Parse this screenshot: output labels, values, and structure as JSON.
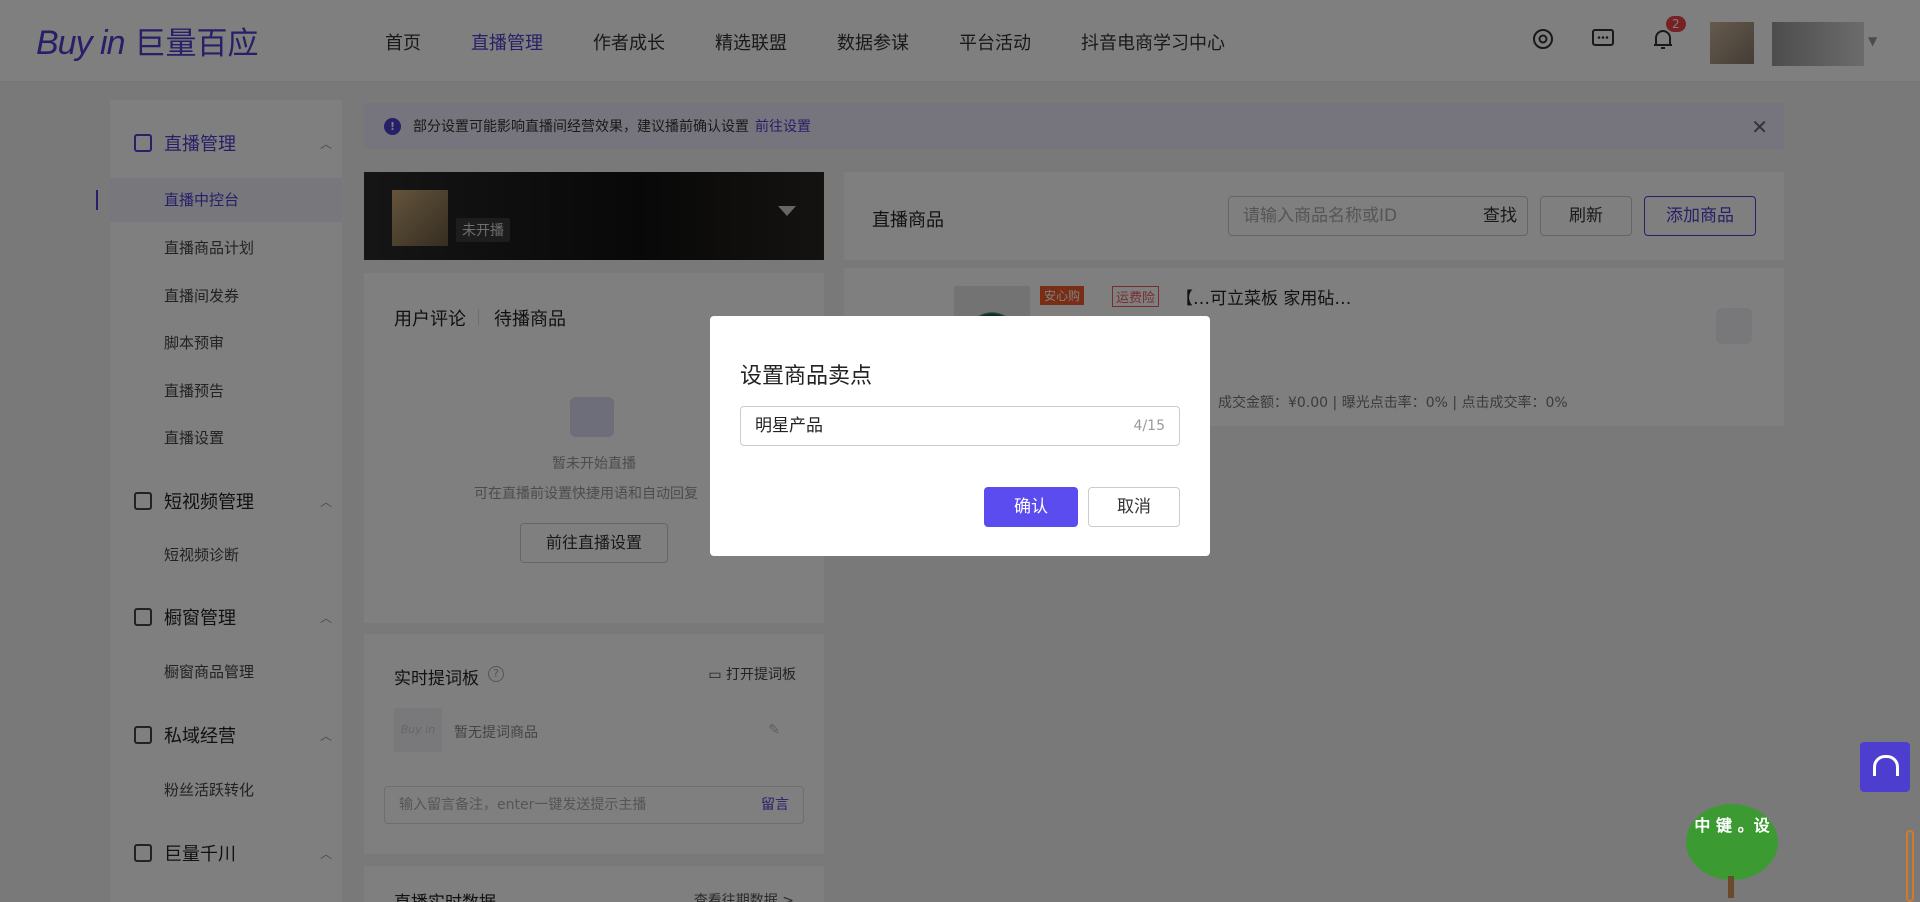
{
  "logo": {
    "en": "Buy in",
    "cn": "巨量百应"
  },
  "nav": [
    {
      "label": "首页",
      "active": false
    },
    {
      "label": "直播管理",
      "active": true
    },
    {
      "label": "作者成长",
      "active": false
    },
    {
      "label": "精选联盟",
      "active": false
    },
    {
      "label": "数据参谋",
      "active": false
    },
    {
      "label": "平台活动",
      "active": false
    },
    {
      "label": "抖音电商学习中心",
      "active": false
    }
  ],
  "header": {
    "notification_count": "2"
  },
  "sidebar": {
    "groups": [
      {
        "label": "直播管理",
        "items": [
          "直播中控台",
          "直播商品计划",
          "直播间发券",
          "脚本预审",
          "直播预告",
          "直播设置"
        ]
      },
      {
        "label": "短视频管理",
        "items": [
          "短视频诊断"
        ]
      },
      {
        "label": "橱窗管理",
        "items": [
          "橱窗商品管理"
        ]
      },
      {
        "label": "私域经营",
        "items": [
          "粉丝活跃转化"
        ]
      },
      {
        "label": "巨量千川",
        "items": []
      }
    ]
  },
  "notice": {
    "text": "部分设置可能影响直播间经营效果，建议播前确认设置",
    "link": "前往设置",
    "icon": "!"
  },
  "room": {
    "status": "未开播"
  },
  "comments": {
    "tab1": "用户评论",
    "tab2": "待播商品",
    "empty_title": "暂未开始直播",
    "empty_sub": "可在直播前设置快捷用语和自动回复",
    "goto_button": "前往直播设置"
  },
  "prompt_board": {
    "title": "实时提词板",
    "help": "?",
    "open_label": "打开提词板",
    "logo_text": "Buy in",
    "empty": "暂无提词商品",
    "remark_placeholder": "输入留言备注，enter一键发送提示主播",
    "remark_button": "留言"
  },
  "realtime": {
    "title": "直播实时数据",
    "link": "查看往期数据 >"
  },
  "goods": {
    "title": "直播商品",
    "search_placeholder": "请输入商品名称或ID",
    "search_button": "查找",
    "refresh_button": "刷新",
    "add_button": "添加商品",
    "item": {
      "tag_safe": "安心购",
      "tag_ship": "运费险",
      "name": "【…可立菜板 家用砧…",
      "stats": "成交金额：¥0.00  |  曝光点击率：0%  |  点击成交率：0%"
    }
  },
  "modal": {
    "title": "设置商品卖点",
    "input_value": "明星产品",
    "count": "4/15",
    "confirm": "确认",
    "cancel": "取消"
  },
  "widget": {
    "tree_text": "中 键 。设"
  },
  "colors": {
    "accent": "#4e3ecf",
    "confirm": "#5b4cf0"
  }
}
